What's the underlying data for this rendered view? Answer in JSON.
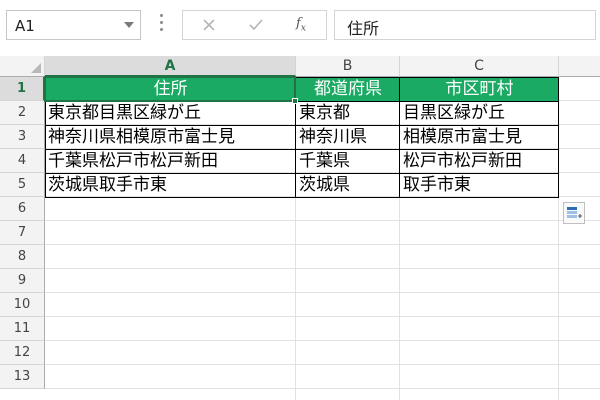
{
  "name_box": {
    "value": "A1"
  },
  "formula_bar": {
    "cancel_icon": "close-icon",
    "enter_icon": "check-icon",
    "fx_label": "f",
    "fx_sub": "x",
    "content": "住所"
  },
  "columns": [
    "A",
    "B",
    "C"
  ],
  "rows": [
    "1",
    "2",
    "3",
    "4",
    "5",
    "6",
    "7",
    "8",
    "9",
    "10",
    "11",
    "12",
    "13"
  ],
  "table": {
    "headers": [
      "住所",
      "都道府県",
      "市区町村"
    ],
    "data": [
      [
        "東京都目黒区緑が丘",
        "東京都",
        "目黒区緑が丘"
      ],
      [
        "神奈川県相模原市富士見",
        "神奈川県",
        "相模原市富士見"
      ],
      [
        "千葉県松戸市松戸新田",
        "千葉県",
        "松戸市松戸新田"
      ],
      [
        "茨城県取手市東",
        "茨城県",
        "取手市東"
      ]
    ]
  },
  "colors": {
    "header_fill": "#1aaa64",
    "accent": "#217346"
  },
  "quick_analysis_icon": "flash-fill-options-icon"
}
